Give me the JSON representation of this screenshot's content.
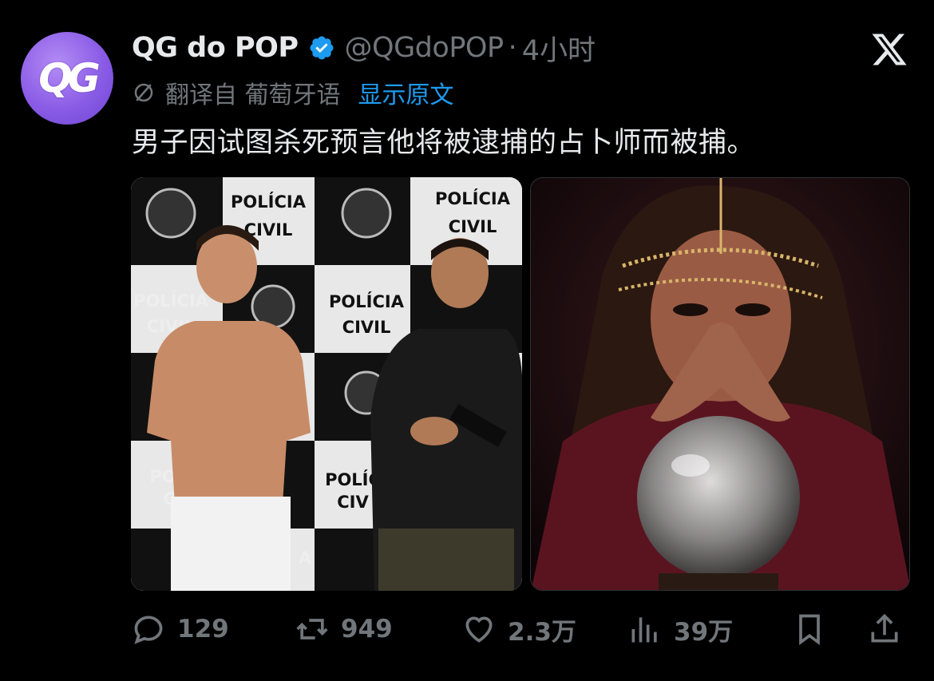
{
  "author": {
    "display_name": "QG do POP",
    "handle": "@QGdoPOP",
    "separator": "·",
    "time": "4小时",
    "avatar_text": "QG"
  },
  "translation": {
    "translated_from": "翻译自 葡萄牙语",
    "show_original": "显示原文"
  },
  "tweet": {
    "text": "男子因试图杀死预言他将被逮捕的占卜师而被捕。"
  },
  "media": {
    "left_photo_signs": [
      "POLÍCIA",
      "CIVIL",
      "POLÍCIA",
      "CIVIL",
      "POLÍCIA",
      "CIVIL",
      "POLÍCIA",
      "CIVIL",
      "POLÍC",
      "CIV",
      "PO",
      "C",
      "A"
    ]
  },
  "actions": {
    "replies": "129",
    "retweets": "949",
    "likes": "2.3万",
    "views": "39万"
  },
  "colors": {
    "background": "#000000",
    "text_primary": "#e7e9ea",
    "text_secondary": "#71767b",
    "link": "#1d9bf0",
    "verified_badge": "#1d9bf0",
    "avatar": "#8a5ce6"
  },
  "icons": {
    "verified": "verified-badge-icon",
    "platform": "x-logo-icon",
    "translate": "translate-icon",
    "reply": "reply-icon",
    "retweet": "retweet-icon",
    "like": "heart-icon",
    "views": "views-icon",
    "bookmark": "bookmark-icon",
    "share": "share-icon"
  }
}
